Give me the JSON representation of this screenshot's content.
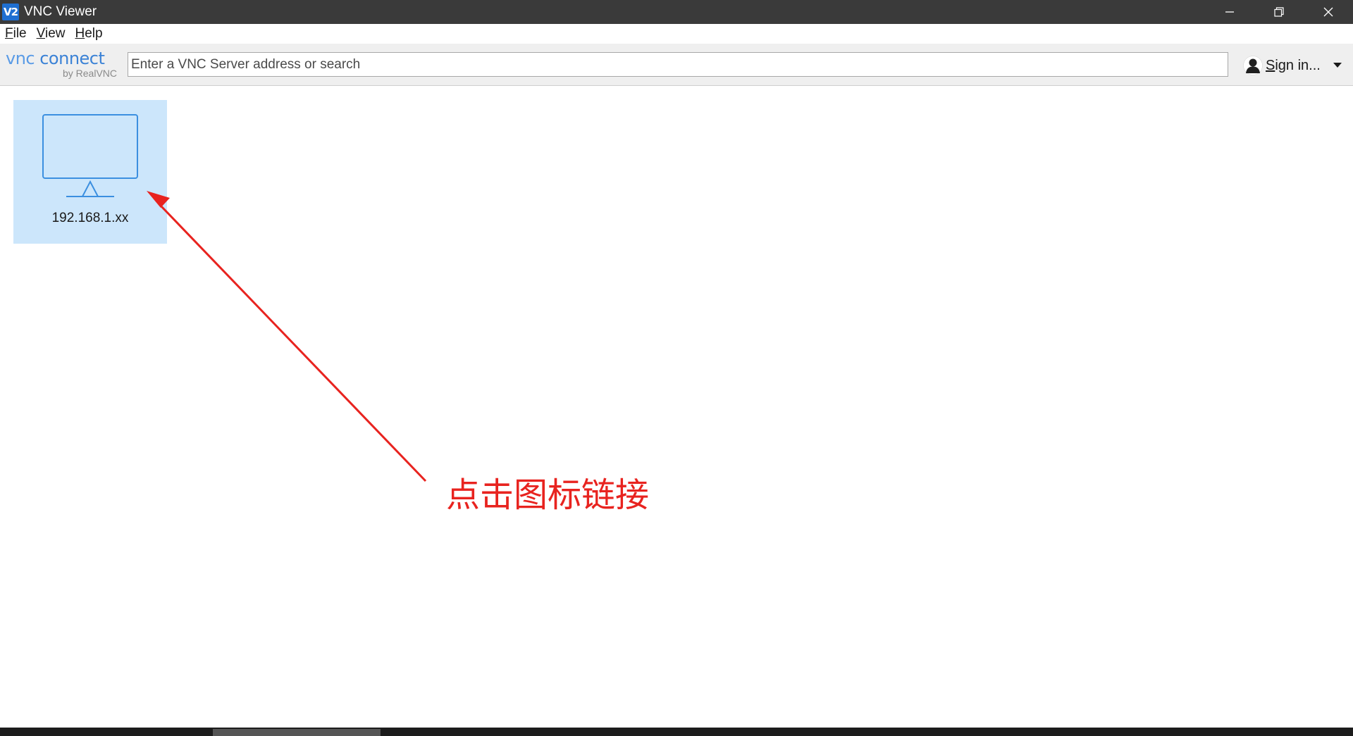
{
  "window": {
    "title": "VNC Viewer",
    "app_icon_text": "V2",
    "controls": [
      "minimize-icon",
      "restore-icon",
      "close-icon"
    ]
  },
  "menu": {
    "items": [
      {
        "first": "F",
        "rest": "ile"
      },
      {
        "first": "V",
        "rest": "iew"
      },
      {
        "first": "H",
        "rest": "elp"
      }
    ]
  },
  "toolbar": {
    "logo_main_a": "vnc",
    "logo_main_b": " connect",
    "logo_sub": "by RealVNC",
    "search_placeholder": "Enter a VNC Server address or search",
    "signin_first": "S",
    "signin_rest": "ign in..."
  },
  "addressbook": {
    "items": [
      {
        "label": "192.168.1.xx",
        "icon": "monitor-icon",
        "selected": true
      }
    ]
  },
  "annotation": {
    "text": "点击图标链接",
    "color": "#e8231f"
  },
  "colors": {
    "titlebar": "#3a3a3a",
    "accent": "#3b82d6",
    "selection": "#cce6fb"
  }
}
